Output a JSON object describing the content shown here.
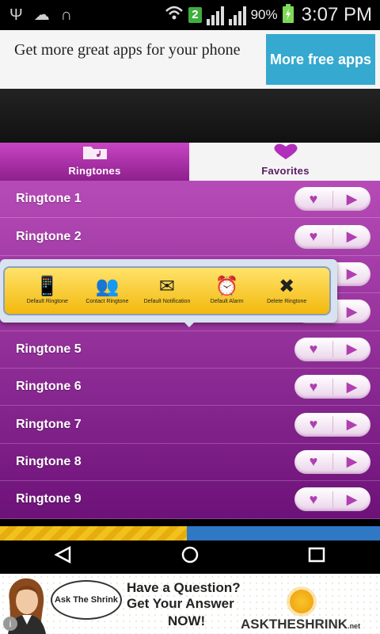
{
  "status_bar": {
    "icons_left": [
      "usb-icon",
      "soundcloud-icon",
      "headphones-icon"
    ],
    "icons_right": [
      "wifi-icon",
      "sim-icon",
      "signal-icon",
      "signal-icon-2",
      "battery-icon"
    ],
    "sim_badge": "2",
    "battery": "90%",
    "time": "3:07 PM"
  },
  "ad_top": {
    "text": "Get more great apps for your phone",
    "button": "More free apps"
  },
  "tabs": [
    {
      "label": "Ringtones",
      "icon": "folder-music-icon",
      "selected": true
    },
    {
      "label": "Favorites",
      "icon": "heart-icon",
      "selected": false
    }
  ],
  "ringtones": [
    {
      "label": "Ringtone 1"
    },
    {
      "label": "Ringtone 2"
    },
    {
      "label": ""
    },
    {
      "label": ""
    },
    {
      "label": "Ringtone 5"
    },
    {
      "label": "Ringtone 6"
    },
    {
      "label": "Ringtone 7"
    },
    {
      "label": "Ringtone 8"
    },
    {
      "label": "Ringtone 9"
    }
  ],
  "popup": {
    "items": [
      {
        "label": "Default Ringtone",
        "icon": "phone-ringing-icon"
      },
      {
        "label": "Contact Ringtone",
        "icon": "contacts-icon"
      },
      {
        "label": "Default Notification",
        "icon": "envelope-icon"
      },
      {
        "label": "Default Alarm",
        "icon": "alarm-clock-icon"
      },
      {
        "label": "Delete Ringtone",
        "icon": "delete-x-icon"
      }
    ]
  },
  "ad_bottom": {
    "bubble": "Ask The Shrink",
    "headline": "Have a Question? Get Your Answer",
    "now": "NOW!",
    "brand": "ASKTHESHRINK",
    "brand_suffix": ".net"
  },
  "colors": {
    "row_top": "#b64bb7",
    "row_bottom": "#6d1279",
    "accent": "#35a9cf"
  }
}
